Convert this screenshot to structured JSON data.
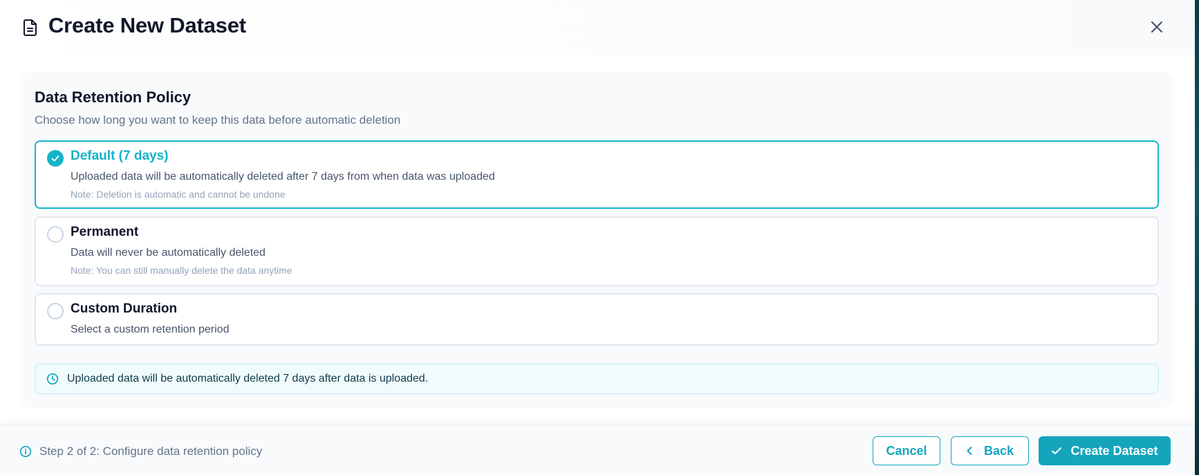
{
  "header": {
    "title": "Create New Dataset",
    "icons": {
      "title": "document-icon",
      "close": "close-icon"
    }
  },
  "retention": {
    "title": "Data Retention Policy",
    "subtitle": "Choose how long you want to keep this data before automatic deletion",
    "options": [
      {
        "label": "Default (7 days)",
        "description": "Uploaded data will be automatically deleted after 7 days from when data was uploaded",
        "note": "Note: Deletion is automatic and cannot be undone",
        "selected": true
      },
      {
        "label": "Permanent",
        "description": "Data will never be automatically deleted",
        "note": "Note: You can still manually delete the data anytime",
        "selected": false
      },
      {
        "label": "Custom Duration",
        "description": "Select a custom retention period",
        "selected": false
      }
    ],
    "info": {
      "icon": "clock-icon",
      "text": "Uploaded data will be automatically deleted 7 days after data is uploaded."
    }
  },
  "footer": {
    "step_icon": "info-circle-icon",
    "step_text": "Step 2 of 2: Configure data retention policy",
    "cancel_label": "Cancel",
    "back_label": "Back",
    "create_label": "Create Dataset"
  },
  "colors": {
    "accent": "#14b3c9",
    "button": "#14a5bd",
    "text_primary": "#0f172a",
    "text_muted": "#64748b",
    "border": "#e2e8f0",
    "info_bg": "#f0fbfd"
  }
}
